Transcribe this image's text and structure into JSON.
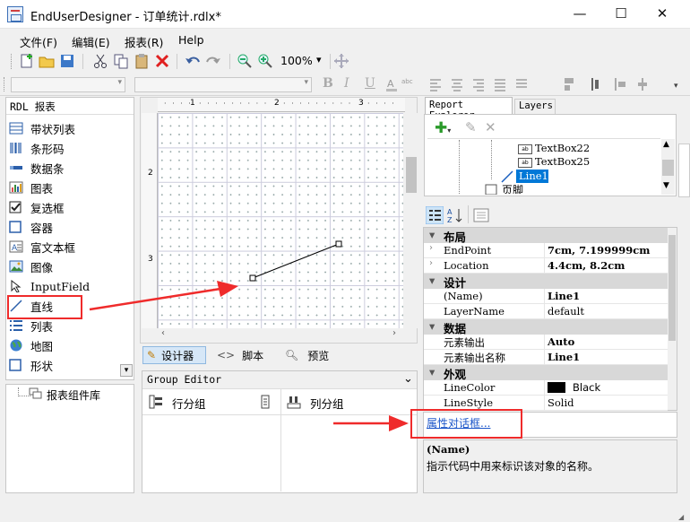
{
  "window": {
    "title": "EndUserDesigner - 订单统计.rdlx*",
    "minimize": "—",
    "maximize": "☐",
    "close": "✕"
  },
  "menu": [
    "文件(F)",
    "编辑(E)",
    "报表(R)",
    "Help"
  ],
  "toolbar": {
    "zoom": "100%",
    "zoom_arrow": "▾"
  },
  "format_toolbar": {
    "bold": "B",
    "italic": "I",
    "underline": "U"
  },
  "toolbox": {
    "header": "RDL 报表",
    "items": [
      "带状列表",
      "条形码",
      "数据条",
      "图表",
      "复选框",
      "容器",
      "富文本框",
      "图像",
      "InputField",
      "直线",
      "列表",
      "地图",
      "形状"
    ],
    "library_label": "报表组件库",
    "scroll_arrow": "▾"
  },
  "ruler": {
    "marks": [
      "1",
      "2",
      "3"
    ],
    "vmarks": [
      "2",
      "3"
    ]
  },
  "designer_tabs": {
    "designer": "设计器",
    "script": "脚本",
    "preview": "预览"
  },
  "group_editor": {
    "title": "Group Editor",
    "row_group": "行分组",
    "col_group": "列分组",
    "toggle": "⌄"
  },
  "explorer": {
    "tabs": [
      "Report Explorer",
      "Layers"
    ],
    "tree": [
      "TextBox22",
      "TextBox25",
      "Line1",
      "页脚"
    ]
  },
  "properties": {
    "sections": [
      {
        "name": "布局",
        "rows": [
          [
            "EndPoint",
            "7cm, 7.199999cm"
          ],
          [
            "Location",
            "4.4cm, 8.2cm"
          ]
        ]
      },
      {
        "name": "设计",
        "rows": [
          [
            "(Name)",
            "Line1"
          ],
          [
            "LayerName",
            "default"
          ]
        ]
      },
      {
        "name": "数据",
        "rows": [
          [
            "元素输出",
            "Auto"
          ],
          [
            "元素输出名称",
            "Line1"
          ]
        ]
      },
      {
        "name": "外观",
        "rows": [
          [
            "LineColor",
            "Black"
          ],
          [
            "LineStyle",
            "Solid"
          ]
        ]
      }
    ],
    "dialog_link": "属性对话框...",
    "help_title": "(Name)",
    "help_text": "指示代码中用来标识该对象的名称。"
  },
  "colors": {
    "accent": "#0078d7",
    "highlight_red": "#ef2b2b",
    "selection": "#0078d7"
  }
}
